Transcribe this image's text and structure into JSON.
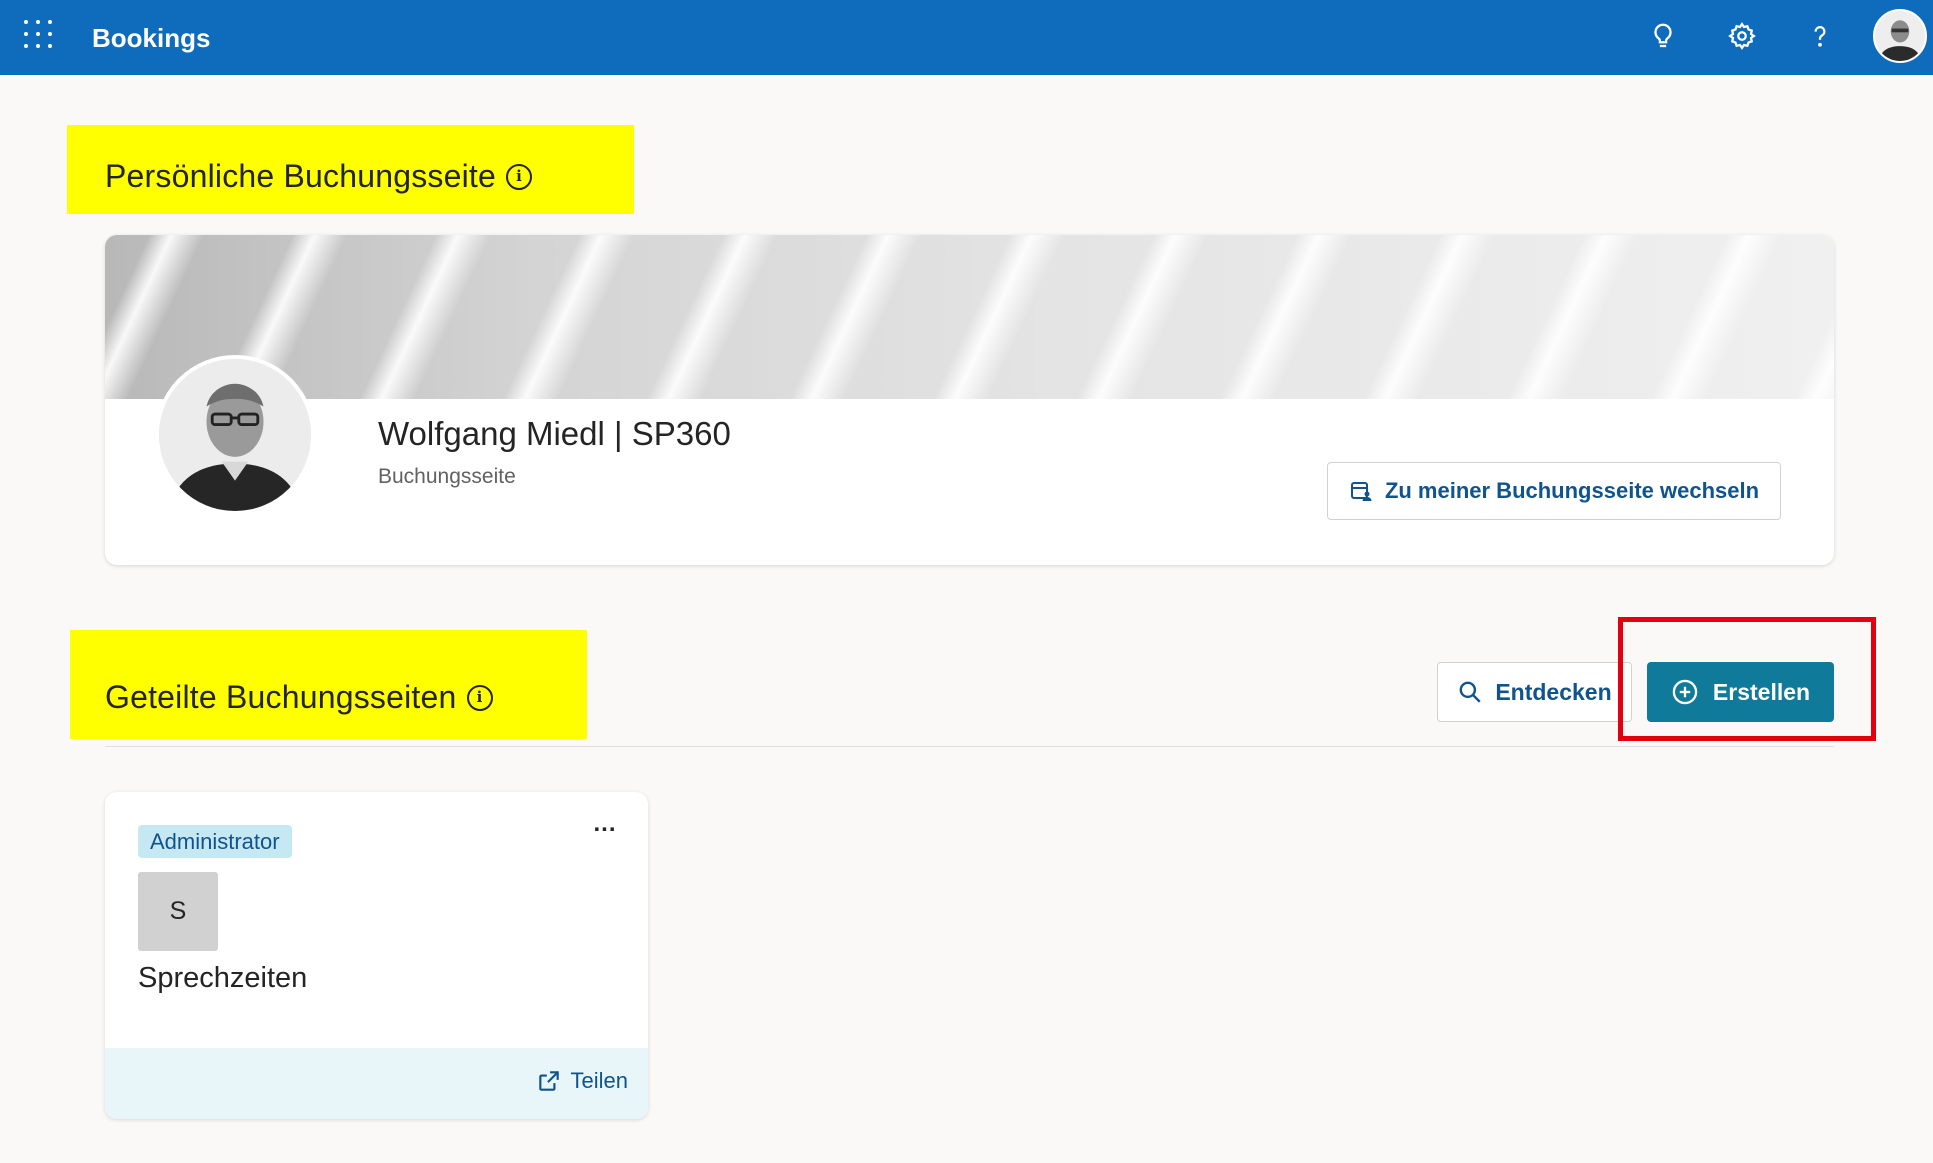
{
  "app": {
    "title": "Bookings",
    "accent_color": "#0f6cbd",
    "top_icons": [
      "lightbulb-icon",
      "gear-icon",
      "help-icon"
    ]
  },
  "personal_section": {
    "heading": "Persönliche Buchungsseite",
    "info_glyph": "i",
    "owner_name": "Wolfgang Miedl | SP360",
    "owner_subtitle": "Buchungsseite",
    "switch_button_label": "Zu meiner Buchungsseite wechseln"
  },
  "shared_section": {
    "heading": "Geteilte Buchungsseiten",
    "info_glyph": "i",
    "discover_label": "Entdecken",
    "create_label": "Erstellen",
    "create_button_color": "#0f7a99",
    "highlight_color": "#e3000f",
    "cards": [
      {
        "role": "Administrator",
        "initial": "S",
        "title": "Sprechzeiten",
        "more_label": "...",
        "share_label": "Teilen"
      }
    ]
  }
}
